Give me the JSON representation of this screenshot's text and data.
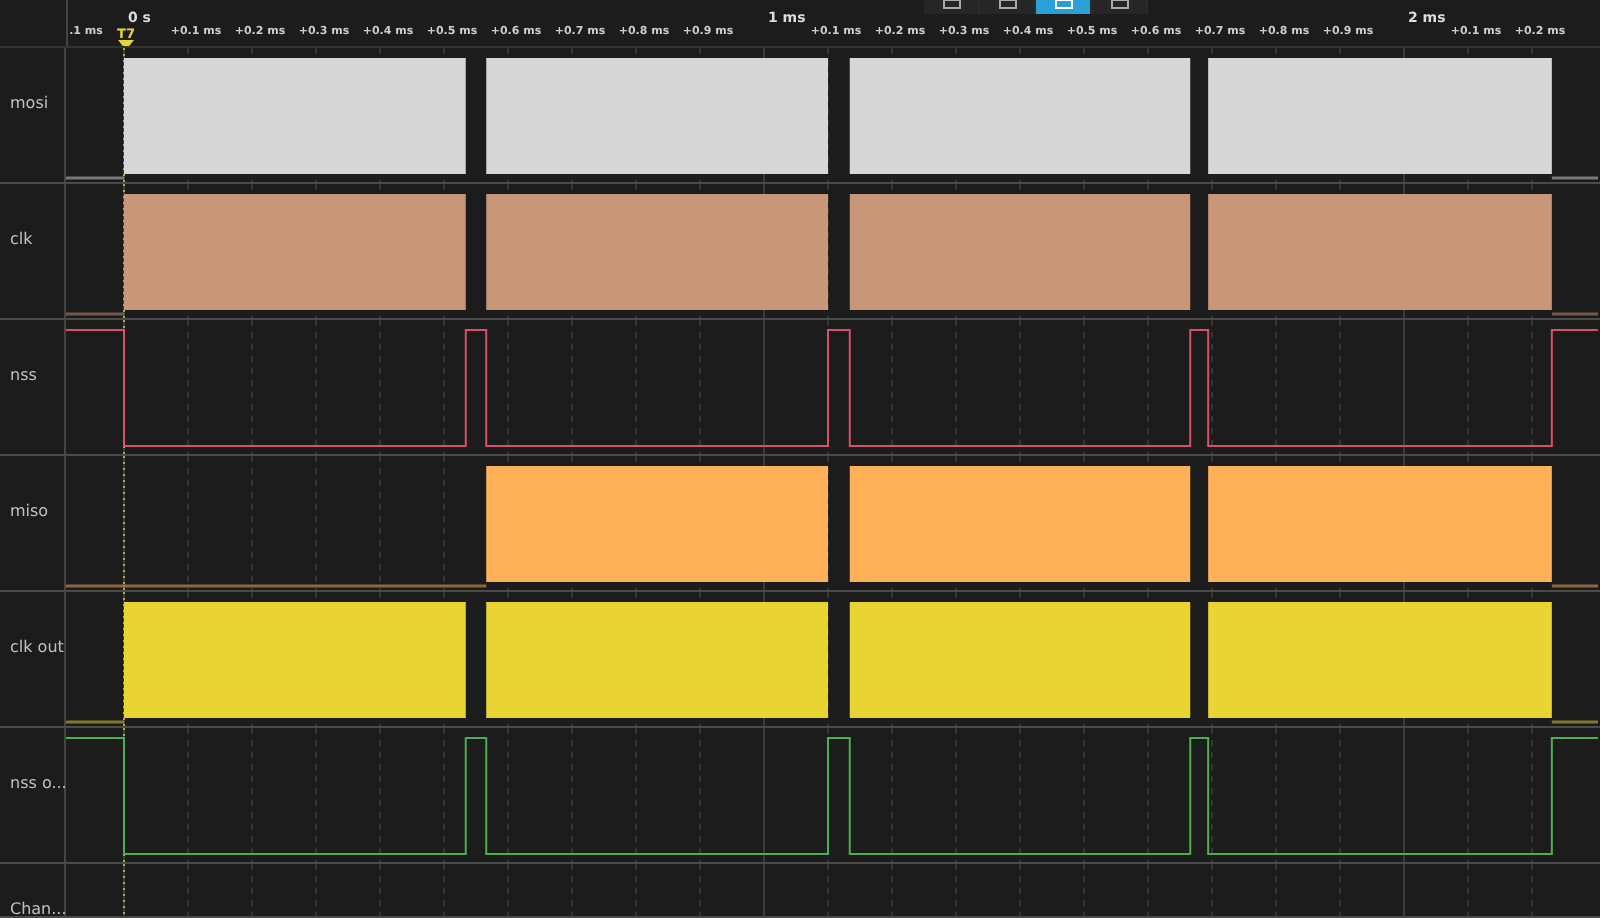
{
  "toolbar": [
    {
      "selected": false
    },
    {
      "selected": false
    },
    {
      "selected": true
    },
    {
      "selected": false
    }
  ],
  "ruler": {
    "major": [
      "0 s",
      "1 ms",
      "2 ms"
    ],
    "minor": [
      ".1 ms",
      "+0.1 ms",
      "+0.2 ms",
      "+0.3 ms",
      "+0.4 ms",
      "+0.5 ms",
      "+0.6 ms",
      "+0.7 ms",
      "+0.8 ms",
      "+0.9 ms",
      "+0.1 ms",
      "+0.2 ms",
      "+0.3 ms",
      "+0.4 ms",
      "+0.5 ms",
      "+0.6 ms",
      "+0.7 ms",
      "+0.8 ms",
      "+0.9 ms",
      "+0.1 ms",
      "+0.2 ms"
    ],
    "trigger": "T7"
  },
  "channels": [
    {
      "name": "mosi",
      "kind": "bus",
      "color": "#d6d6d6"
    },
    {
      "name": "clk",
      "kind": "bus",
      "color": "#c8977a"
    },
    {
      "name": "nss",
      "kind": "strobe",
      "color": "#d9506a"
    },
    {
      "name": "miso",
      "kind": "bus_late",
      "color": "#ffb15a"
    },
    {
      "name": "clk out",
      "kind": "bus",
      "color": "#e8d534"
    },
    {
      "name": "nss o...",
      "kind": "strobe",
      "color": "#4caf50"
    },
    {
      "name": "Chan...",
      "kind": "empty"
    }
  ]
}
